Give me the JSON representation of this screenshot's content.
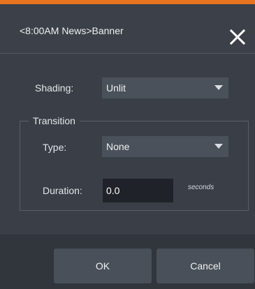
{
  "dialog": {
    "title": "<8:00AM News>Banner",
    "accent_color": "#e8731f"
  },
  "shading": {
    "label": "Shading:",
    "value": "Unlit"
  },
  "transition": {
    "legend": "Transition",
    "type_label": "Type:",
    "type_value": "None",
    "duration_label": "Duration:",
    "duration_value": "0.0",
    "duration_unit": "seconds"
  },
  "buttons": {
    "ok": "OK",
    "cancel": "Cancel"
  },
  "icons": {
    "close": "close-icon",
    "dropdown": "chevron-down-icon"
  }
}
